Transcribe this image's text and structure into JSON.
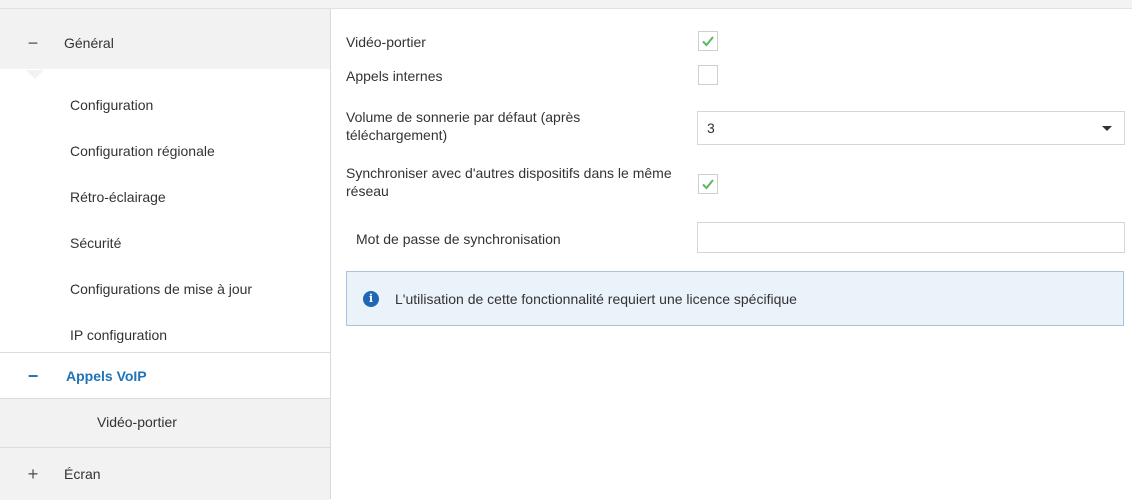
{
  "sidebar": {
    "general": {
      "sign": "−",
      "label": "Général"
    },
    "items": [
      {
        "label": "Configuration"
      },
      {
        "label": "Configuration régionale"
      },
      {
        "label": "Rétro-éclairage"
      },
      {
        "label": "Sécurité"
      },
      {
        "label": "Configurations de mise à jour"
      },
      {
        "label": "IP configuration"
      }
    ],
    "active_group": {
      "sign": "−",
      "label": "Appels VoIP"
    },
    "active_sub": {
      "label": "Vidéo-portier"
    },
    "screen_group": {
      "sign": "+",
      "label": "Écran"
    }
  },
  "main": {
    "video_portier": {
      "label": "Vidéo-portier",
      "checked": true
    },
    "appels_internes": {
      "label": "Appels internes",
      "checked": false
    },
    "volume": {
      "label": "Volume de sonnerie par défaut (après téléchargement)",
      "value": "3"
    },
    "sync": {
      "label": "Synchroniser avec d'autres dispositifs dans le même réseau",
      "checked": true
    },
    "password": {
      "label": "Mot de passe de synchronisation",
      "value": ""
    },
    "info": {
      "icon": "info-icon",
      "text": "L'utilisation de cette fonctionnalité requiert une licence spécifique"
    }
  },
  "colors": {
    "accent": "#1f73b7",
    "check": "#5cb85c",
    "info_bg": "#eaf2fa"
  }
}
